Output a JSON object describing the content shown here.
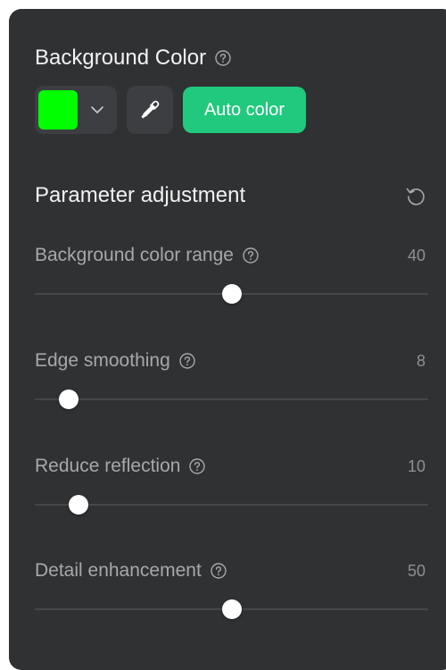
{
  "background_color": {
    "title": "Background Color",
    "swatch_color": "#00ff00",
    "auto_color_label": "Auto color",
    "auto_color_bg": "#20c97d"
  },
  "parameters": {
    "title": "Parameter adjustment",
    "items": [
      {
        "label": "Background color range",
        "value": "40",
        "fraction": 0.5
      },
      {
        "label": "Edge smoothing",
        "value": "8",
        "fraction": 0.086
      },
      {
        "label": "Reduce reflection",
        "value": "10",
        "fraction": 0.11
      },
      {
        "label": "Detail enhancement",
        "value": "50",
        "fraction": 0.5
      }
    ]
  },
  "icons": {
    "help": "question-circle-icon",
    "chevron": "chevron-down-icon",
    "eyedropper": "eyedropper-icon",
    "reset": "reset-icon"
  }
}
